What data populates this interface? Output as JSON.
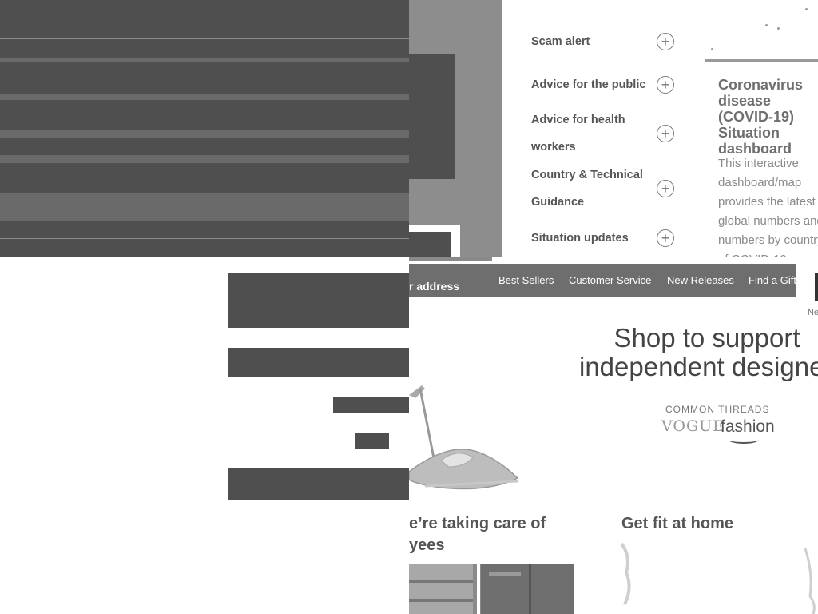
{
  "who": {
    "top_cut_text": "",
    "accordion": [
      {
        "label": "Scam alert"
      },
      {
        "label": "Advice for the public"
      },
      {
        "label": "Advice for health workers"
      },
      {
        "label": "Country & Technical Guidance"
      },
      {
        "label": "Situation updates"
      }
    ],
    "plus_icon": "+",
    "card": {
      "title": "Coronavirus disease (COVID-19) Situation dashboard",
      "text": "This interactive dashboard/map provides the latest global numbers and numbers by country of COVID-19"
    }
  },
  "amazon": {
    "nav_address": "r address",
    "nav_links": [
      "Best Sellers",
      "Customer Service",
      "New Releases",
      "Find a Gift"
    ],
    "nav_cut_label": "Ne",
    "hero": {
      "line1": "Shop to support",
      "line2": "independent designe",
      "common_threads": "COMMON THREADS",
      "vogue": "VOGUE",
      "fashion": "fashion"
    },
    "sections": {
      "care_title": "e’re taking care of",
      "care_title_line2": "yees",
      "fit_title": "Get fit at home"
    }
  }
}
